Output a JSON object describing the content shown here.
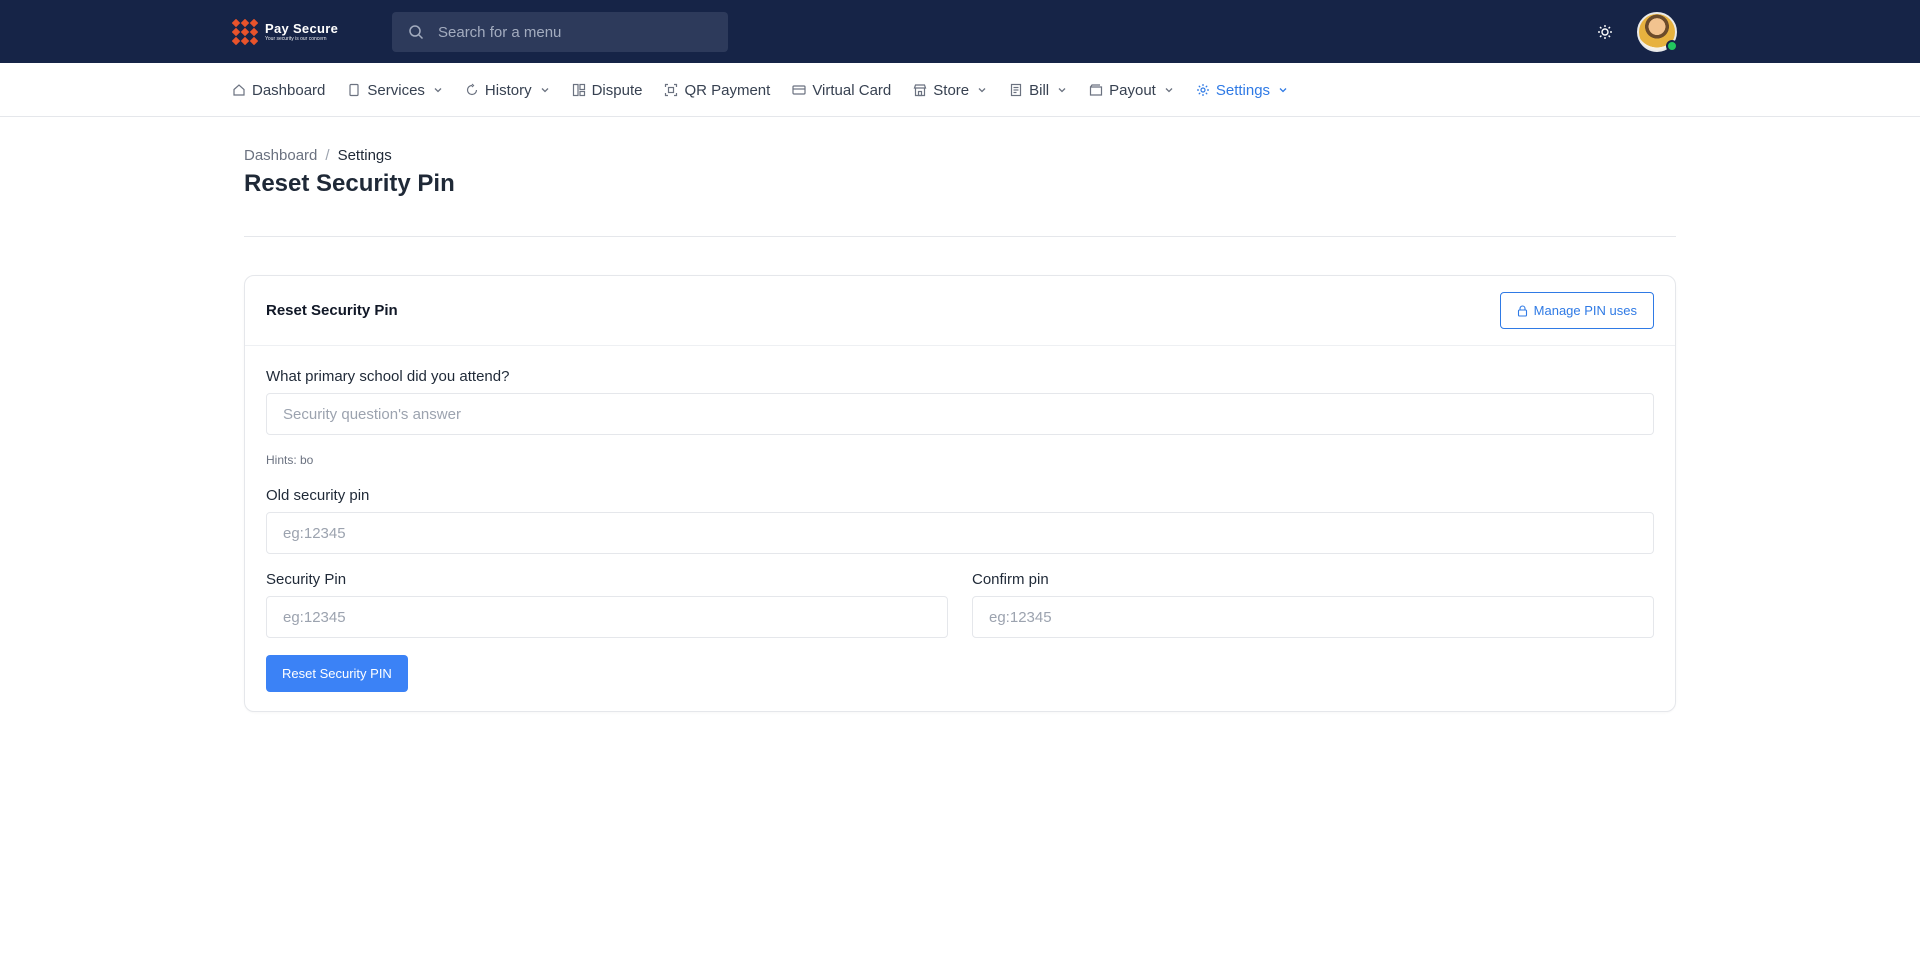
{
  "brand": {
    "name": "Pay Secure",
    "tagline": "Your security is our concern",
    "logo_color": "#e8532b"
  },
  "topbar": {
    "bg_color": "#162447",
    "search_placeholder": "Search for a menu",
    "search_icon": "search-icon",
    "theme_icon": "sun-icon",
    "avatar_status": "online"
  },
  "nav": {
    "items": [
      {
        "label": "Dashboard",
        "icon": "home-icon",
        "dropdown": false,
        "active": false
      },
      {
        "label": "Services",
        "icon": "document-icon",
        "dropdown": true,
        "active": false
      },
      {
        "label": "History",
        "icon": "refresh-icon",
        "dropdown": true,
        "active": false
      },
      {
        "label": "Dispute",
        "icon": "columns-icon",
        "dropdown": false,
        "active": false
      },
      {
        "label": "QR Payment",
        "icon": "qr-scan-icon",
        "dropdown": false,
        "active": false
      },
      {
        "label": "Virtual Card",
        "icon": "card-icon",
        "dropdown": false,
        "active": false
      },
      {
        "label": "Store",
        "icon": "store-icon",
        "dropdown": true,
        "active": false
      },
      {
        "label": "Bill",
        "icon": "bill-icon",
        "dropdown": true,
        "active": false
      },
      {
        "label": "Payout",
        "icon": "wallet-icon",
        "dropdown": true,
        "active": false
      },
      {
        "label": "Settings",
        "icon": "gear-icon",
        "dropdown": true,
        "active": true
      }
    ],
    "active_color": "#2f7ae5"
  },
  "breadcrumb": {
    "home": "Dashboard",
    "separator": "/",
    "current": "Settings"
  },
  "page": {
    "title": "Reset Security Pin"
  },
  "card": {
    "title": "Reset Security Pin",
    "manage_button": "Manage PIN uses",
    "security_question": {
      "label": "What primary school did you attend?",
      "placeholder": "Security question's answer",
      "hint": "Hints: bo"
    },
    "old_pin": {
      "label": "Old security pin",
      "placeholder": "eg:12345"
    },
    "new_pin": {
      "label": "Security Pin",
      "placeholder": "eg:12345"
    },
    "confirm_pin": {
      "label": "Confirm pin",
      "placeholder": "eg:12345"
    },
    "submit_button": "Reset Security PIN",
    "primary_color": "#3b82f6"
  }
}
